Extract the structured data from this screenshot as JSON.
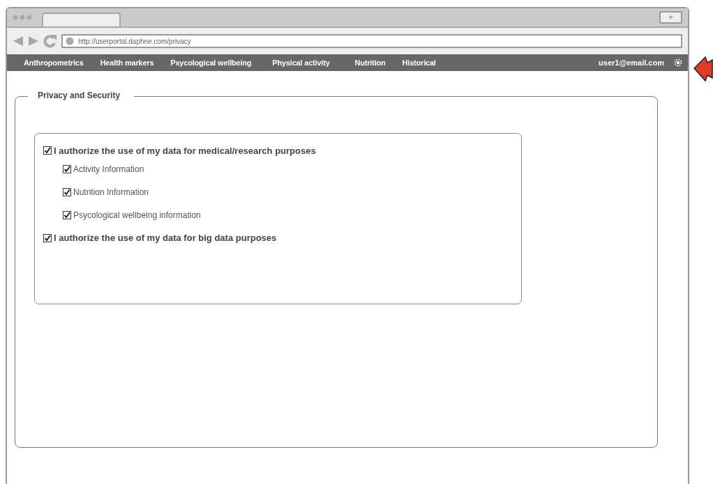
{
  "browser": {
    "url": "http://userportal.daphne.com/privacy",
    "new_tab": "+"
  },
  "nav": {
    "items": [
      {
        "label": "Anthropometrics"
      },
      {
        "label": "Health markers"
      },
      {
        "label": "Psycological wellbeing"
      },
      {
        "label": "Physical activity"
      },
      {
        "label": "Nutrition"
      },
      {
        "label": "Historical"
      }
    ],
    "user": "user1@email.com"
  },
  "section": {
    "title": "Privacy and Security",
    "consents": [
      {
        "label": "I authorize the use of my data for medical/research purposes",
        "checked": true,
        "children": [
          {
            "label": "Activity Information",
            "checked": true
          },
          {
            "label": "Nutrition Information",
            "checked": true
          },
          {
            "label": "Psycological wellbeing information",
            "checked": true
          }
        ]
      },
      {
        "label": "I authorize the use of my data for big data purposes",
        "checked": true
      }
    ]
  }
}
